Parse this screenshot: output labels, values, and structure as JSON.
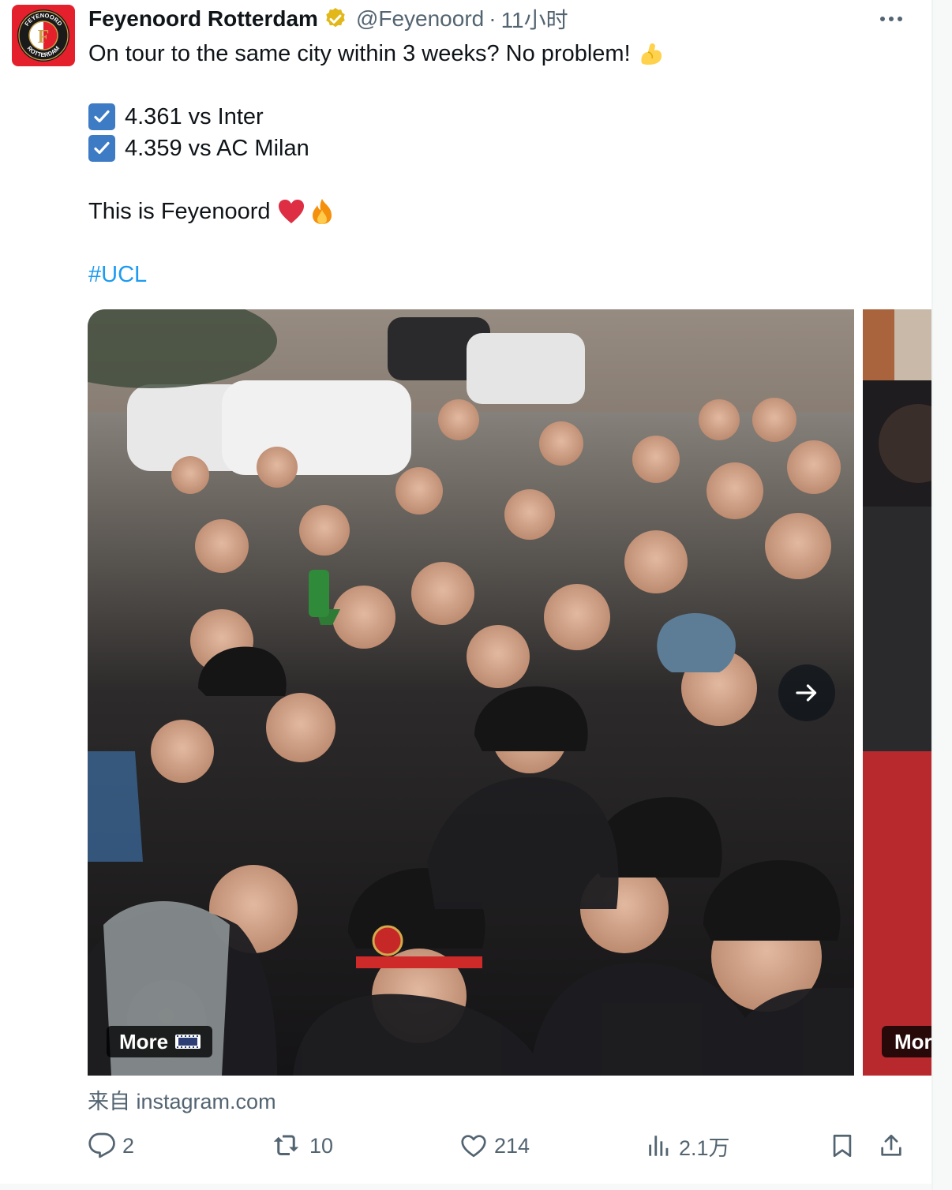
{
  "tweet": {
    "author_name": "Feyenoord Rotterdam",
    "handle": "@Feyenoord",
    "separator": "·",
    "time": "11小时",
    "line1": "On tour to the same city within 3 weeks? No problem!",
    "line2": "4.361 vs Inter",
    "line3": "4.359 vs AC Milan",
    "line4": "This is Feyenoord",
    "hashtag": "#UCL",
    "source": "来自 instagram.com"
  },
  "avatar": {
    "top_text": "FEYENOORD",
    "bottom_text": "ROTTERDAM",
    "letter": "F"
  },
  "media": {
    "more_label": "More",
    "more_label_2": "Mor"
  },
  "actions": {
    "replies": "2",
    "retweets": "10",
    "likes": "214",
    "views": "2.1万"
  },
  "colors": {
    "link": "#1d9bf0",
    "secondary_text": "#536471",
    "brand_red": "#e4202c",
    "verified_gold": "#e2b719"
  }
}
